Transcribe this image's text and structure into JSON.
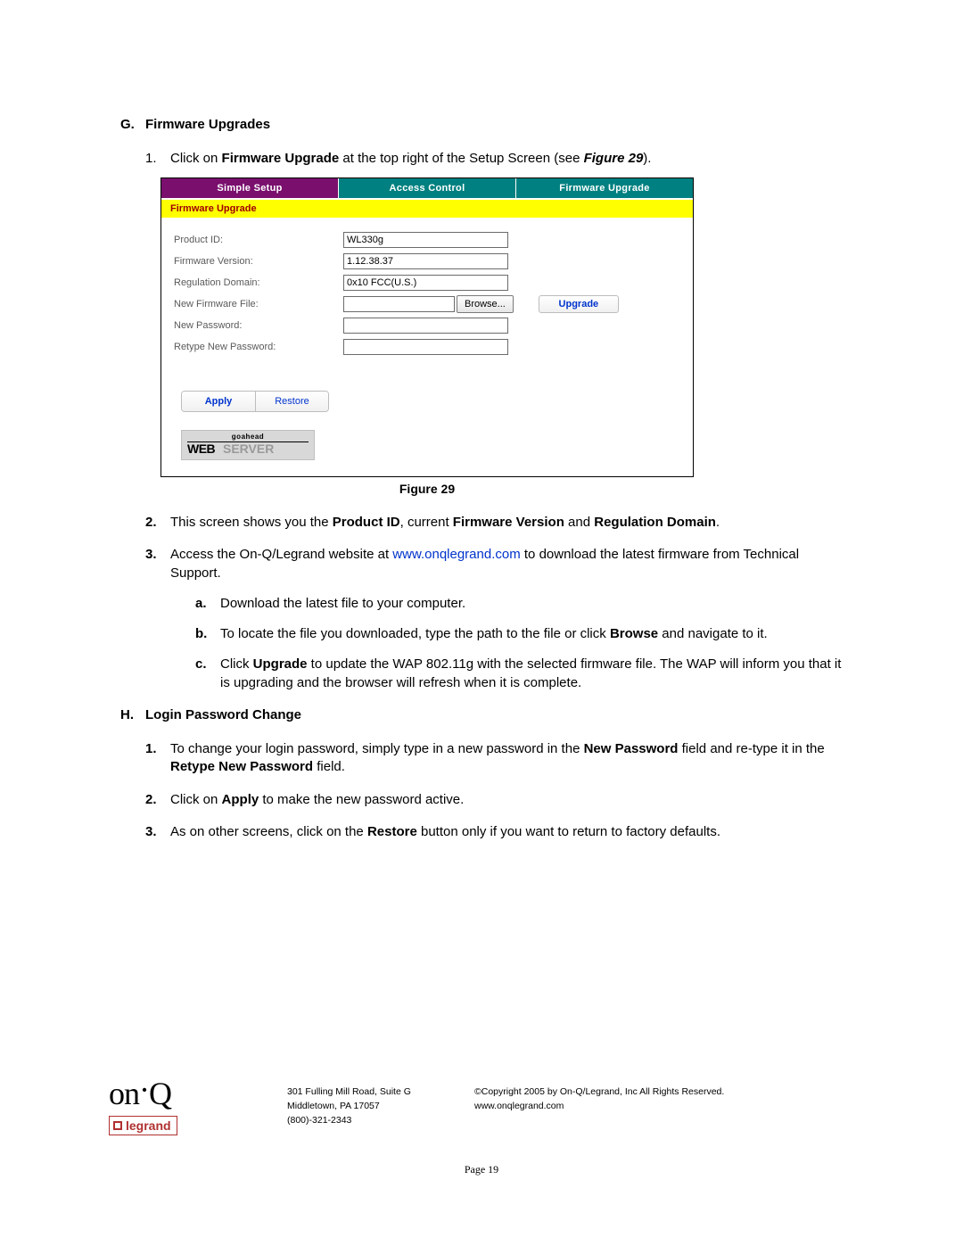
{
  "sectionG": {
    "letter": "G.",
    "title": "Firmware Upgrades",
    "item1_pre": "Click on ",
    "item1_bold": "Firmware Upgrade",
    "item1_mid": " at the top right of the Setup Screen (see ",
    "item1_fig": "Figure 29",
    "item1_end": ").",
    "item2_pre": "This screen shows you the ",
    "item2_b1": "Product ID",
    "item2_m1": ", current ",
    "item2_b2": "Firmware Version",
    "item2_m2": " and ",
    "item2_b3": "Regulation Domain",
    "item2_end": ".",
    "item3_pre": "Access the On-Q/Legrand website at ",
    "item3_link": "www.onqlegrand.com",
    "item3_end": " to download the latest firmware from Technical Support.",
    "a": "Download the latest file to your computer.",
    "b_pre": "To locate the file you downloaded, type the path to the file or click ",
    "b_bold": "Browse",
    "b_end": " and navigate to it.",
    "c_pre": "Click ",
    "c_bold": "Upgrade",
    "c_end": " to update the WAP 802.11g with the selected firmware file. The WAP will inform you that it is upgrading and the browser will refresh when it is complete."
  },
  "figure": {
    "tab1": "Simple Setup",
    "tab2": "Access Control",
    "tab3": "Firmware Upgrade",
    "panel_title": "Firmware Upgrade",
    "labels": {
      "product_id": "Product ID:",
      "firmware_version": "Firmware Version:",
      "regulation_domain": "Regulation Domain:",
      "new_firmware_file": "New Firmware File:",
      "new_password": "New Password:",
      "retype_password": "Retype New Password:"
    },
    "values": {
      "product_id": "WL330g",
      "firmware_version": "1.12.38.37",
      "regulation_domain": "0x10 FCC(U.S.)",
      "new_firmware_file": "",
      "new_password": "",
      "retype_password": ""
    },
    "buttons": {
      "browse": "Browse...",
      "upgrade": "Upgrade",
      "apply": "Apply",
      "restore": "Restore"
    },
    "webserver": {
      "goahead": "goahead",
      "web": "WEB",
      "server": "SERVER"
    },
    "caption": "Figure 29"
  },
  "sectionH": {
    "letter": "H.",
    "title": "Login Password Change",
    "item1_pre": "To change your login password, simply type in a new password in the ",
    "item1_b1": "New Password",
    "item1_m1": " field and re-type it in the ",
    "item1_b2": "Retype New Password",
    "item1_end": " field.",
    "item2_pre": "Click on ",
    "item2_b1": "Apply",
    "item2_end": " to make the new password active.",
    "item3_pre": "As on other screens, click on the ",
    "item3_b1": "Restore",
    "item3_end": " button only if you want to return to factory defaults."
  },
  "footer": {
    "addr1": "301 Fulling Mill Road, Suite G",
    "addr2": "Middletown, PA    17057",
    "phone": "(800)-321-2343",
    "copyright": "©Copyright 2005 by On-Q/Legrand, Inc All Rights Reserved.",
    "web": "www.onqlegrand.com",
    "onq": "on·Q",
    "legrand": "legrand",
    "pagenum": "Page 19"
  }
}
